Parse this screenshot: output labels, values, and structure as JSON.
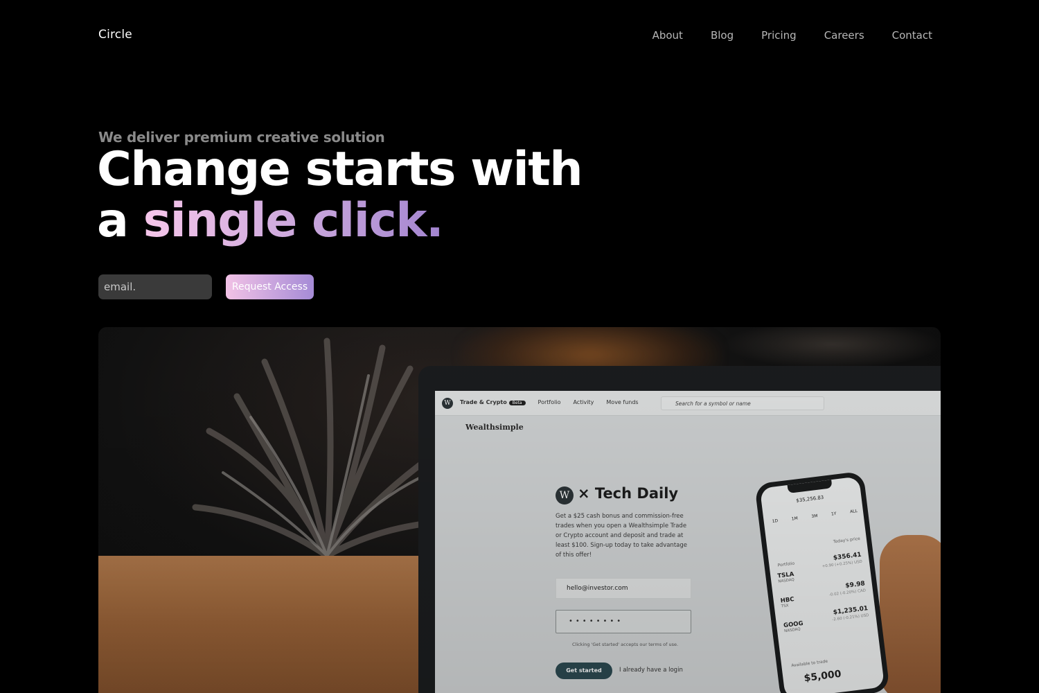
{
  "brand": "Circle",
  "nav": [
    "About",
    "Blog",
    "Pricing",
    "Careers",
    "Contact"
  ],
  "hero": {
    "eyebrow": "We deliver premium creative solution",
    "title_line1": "Change starts with",
    "title_line2_plain": "a ",
    "title_line2_gradient": "single click.",
    "email_placeholder": "email.",
    "cta_label": "Request Access"
  },
  "colors": {
    "background": "#000000",
    "gradient_start": "#f6c6ea",
    "gradient_end": "#a385d0",
    "input_bg": "#3a3a3a"
  },
  "photo": {
    "screen": {
      "nav": [
        "Trade & Crypto",
        "Beta",
        "Portfolio",
        "Activity",
        "Move funds"
      ],
      "search": "Search for a symbol or name",
      "wordmark": "Wealthsimple",
      "logo_letter": "W",
      "heading": "× Tech Daily",
      "copy": "Get a $25 cash bonus and commission-free trades when you open a Wealthsimple Trade or Crypto account and deposit and trade at least $100. Sign-up today to take advantage of this offer!",
      "email": "hello@investor.com",
      "password": "••••••••",
      "terms": "Clicking 'Get started' accepts our terms of use.",
      "button": "Get started",
      "login": "I already have a login"
    },
    "phone": {
      "total": "$35,256.83",
      "ranges": [
        "1D",
        "1M",
        "3M",
        "1Y",
        "ALL"
      ],
      "portfolio_label": "Portfolio",
      "price_label": "Today's price",
      "rows": [
        {
          "ticker": "TSLA",
          "exchange": "NASDAQ",
          "price": "$356.41",
          "change": "+0.90 (+0.25%) USD"
        },
        {
          "ticker": "HBC",
          "exchange": "TSX",
          "price": "$9.98",
          "change": "-0.02 (-0.20%) CAD"
        },
        {
          "ticker": "GOOG",
          "exchange": "NASDAQ",
          "price": "$1,235.01",
          "change": "-2.60 (-0.21%) USD"
        }
      ],
      "available": "Available to trade",
      "available_value": "$5,000"
    }
  }
}
